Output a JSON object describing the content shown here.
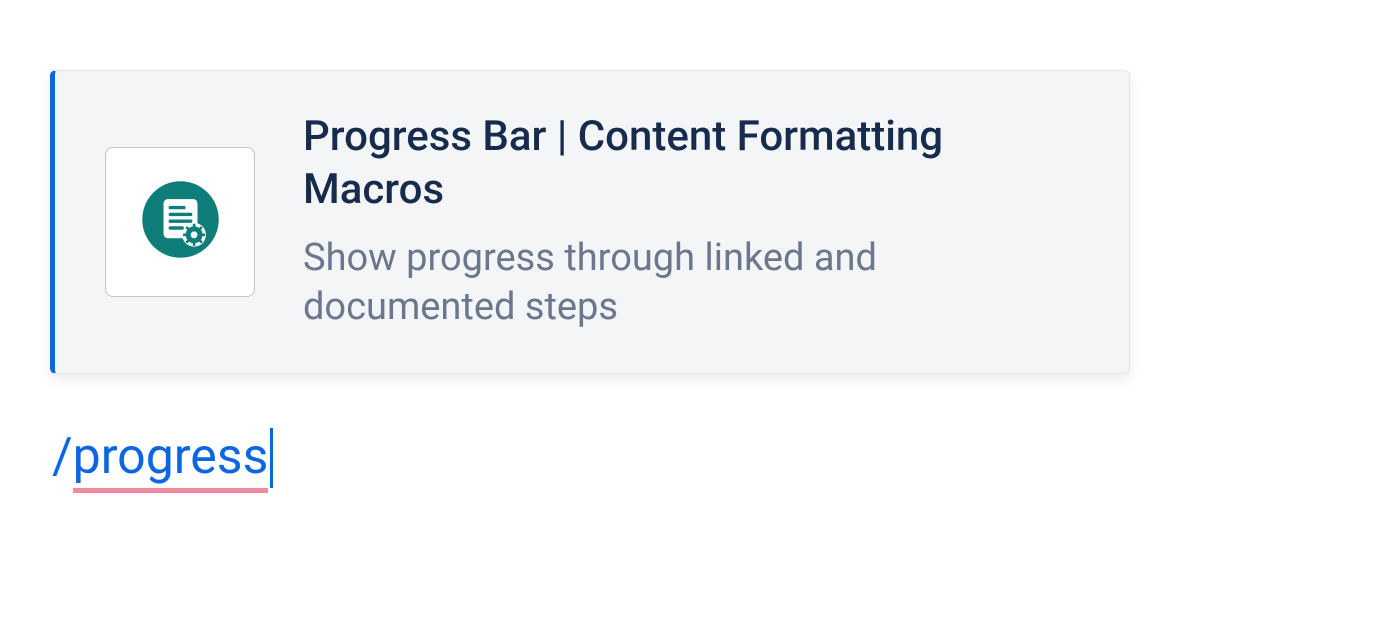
{
  "suggestion": {
    "title": "Progress Bar | Content Formatting Macros",
    "description": "Show progress through linked and documented steps",
    "icon_name": "document-gear-icon",
    "icon_bg": "#0f7d7a"
  },
  "command": {
    "prefix": "/",
    "query": "progress"
  }
}
